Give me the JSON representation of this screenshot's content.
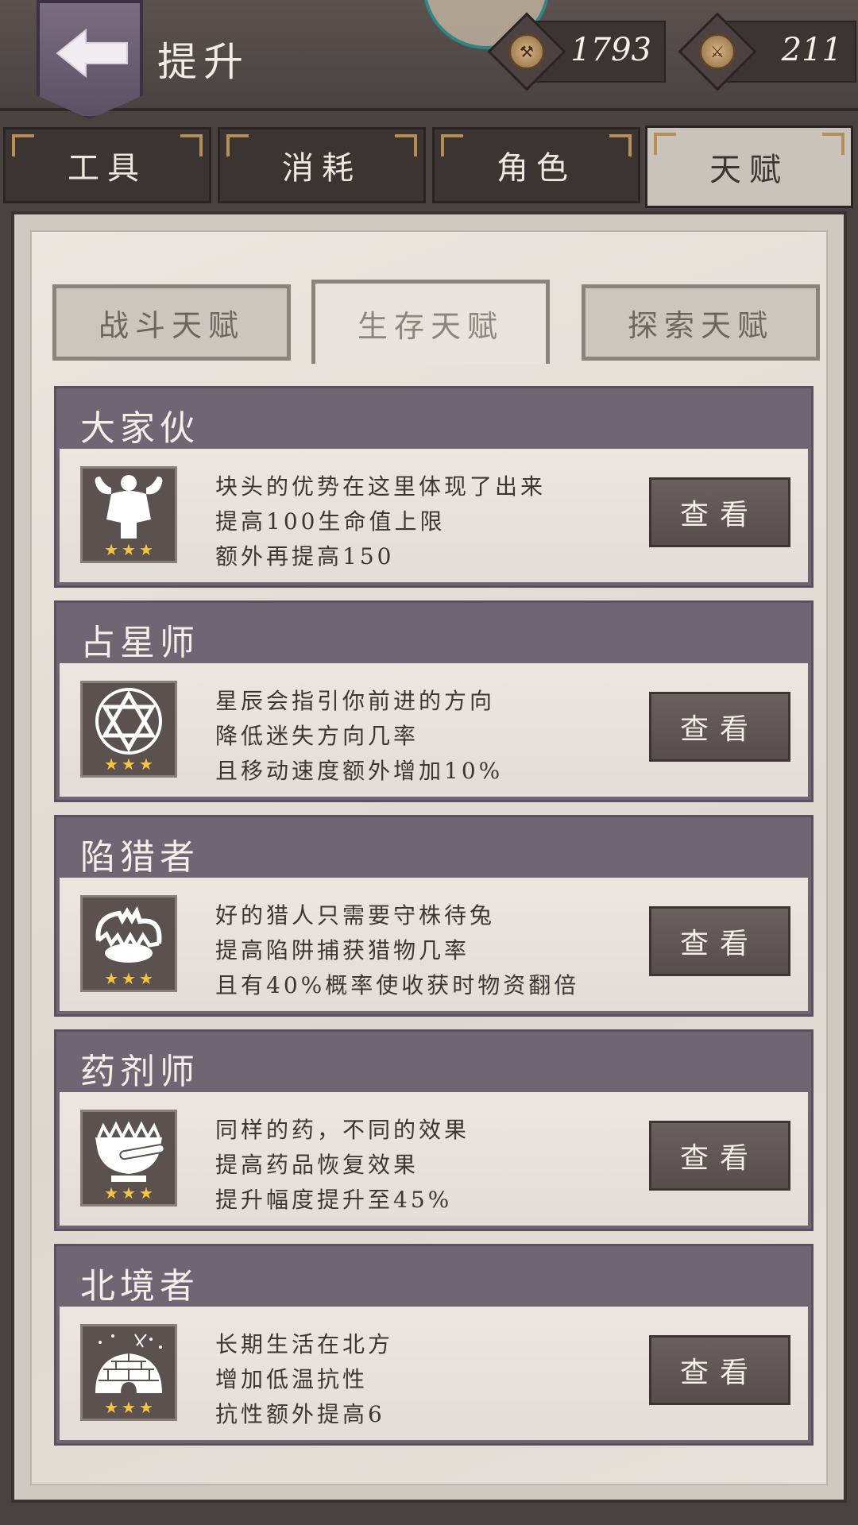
{
  "header": {
    "title": "提升",
    "currencies": [
      {
        "icon": "coin-icon",
        "value": "1793"
      },
      {
        "icon": "talent-coin-icon",
        "value": "211"
      }
    ]
  },
  "main_tabs": [
    {
      "label": "工具"
    },
    {
      "label": "消耗"
    },
    {
      "label": "角色"
    },
    {
      "label": "天赋",
      "active": true
    }
  ],
  "sub_tabs": [
    {
      "label": "战斗天赋"
    },
    {
      "label": "生存天赋",
      "active": true
    },
    {
      "label": "探索天赋"
    }
  ],
  "talents": [
    {
      "name": "大家伙",
      "icon": "muscle-man-icon",
      "stars": 3,
      "lines": [
        "块头的优势在这里体现了出来",
        "提高100生命值上限",
        "额外再提高150"
      ]
    },
    {
      "name": "占星师",
      "icon": "hexagram-icon",
      "stars": 3,
      "lines": [
        "星辰会指引你前进的方向",
        "降低迷失方向几率",
        "且移动速度额外增加10%"
      ]
    },
    {
      "name": "陷猎者",
      "icon": "bear-trap-icon",
      "stars": 3,
      "lines": [
        "好的猎人只需要守株待兔",
        "提高陷阱捕获猎物几率",
        "且有40%概率使收获时物资翻倍"
      ]
    },
    {
      "name": "药剂师",
      "icon": "mortar-pestle-icon",
      "stars": 3,
      "lines": [
        "同样的药，不同的效果",
        "提高药品恢复效果",
        "提升幅度提升至45%"
      ]
    },
    {
      "name": "北境者",
      "icon": "igloo-icon",
      "stars": 3,
      "lines": [
        "长期生活在北方",
        "增加低温抗性",
        "抗性额外提高6"
      ]
    }
  ],
  "view_label": "查看",
  "colors": {
    "card_header": "#6f6573",
    "button": "#5e5554",
    "star": "#f5c542"
  }
}
